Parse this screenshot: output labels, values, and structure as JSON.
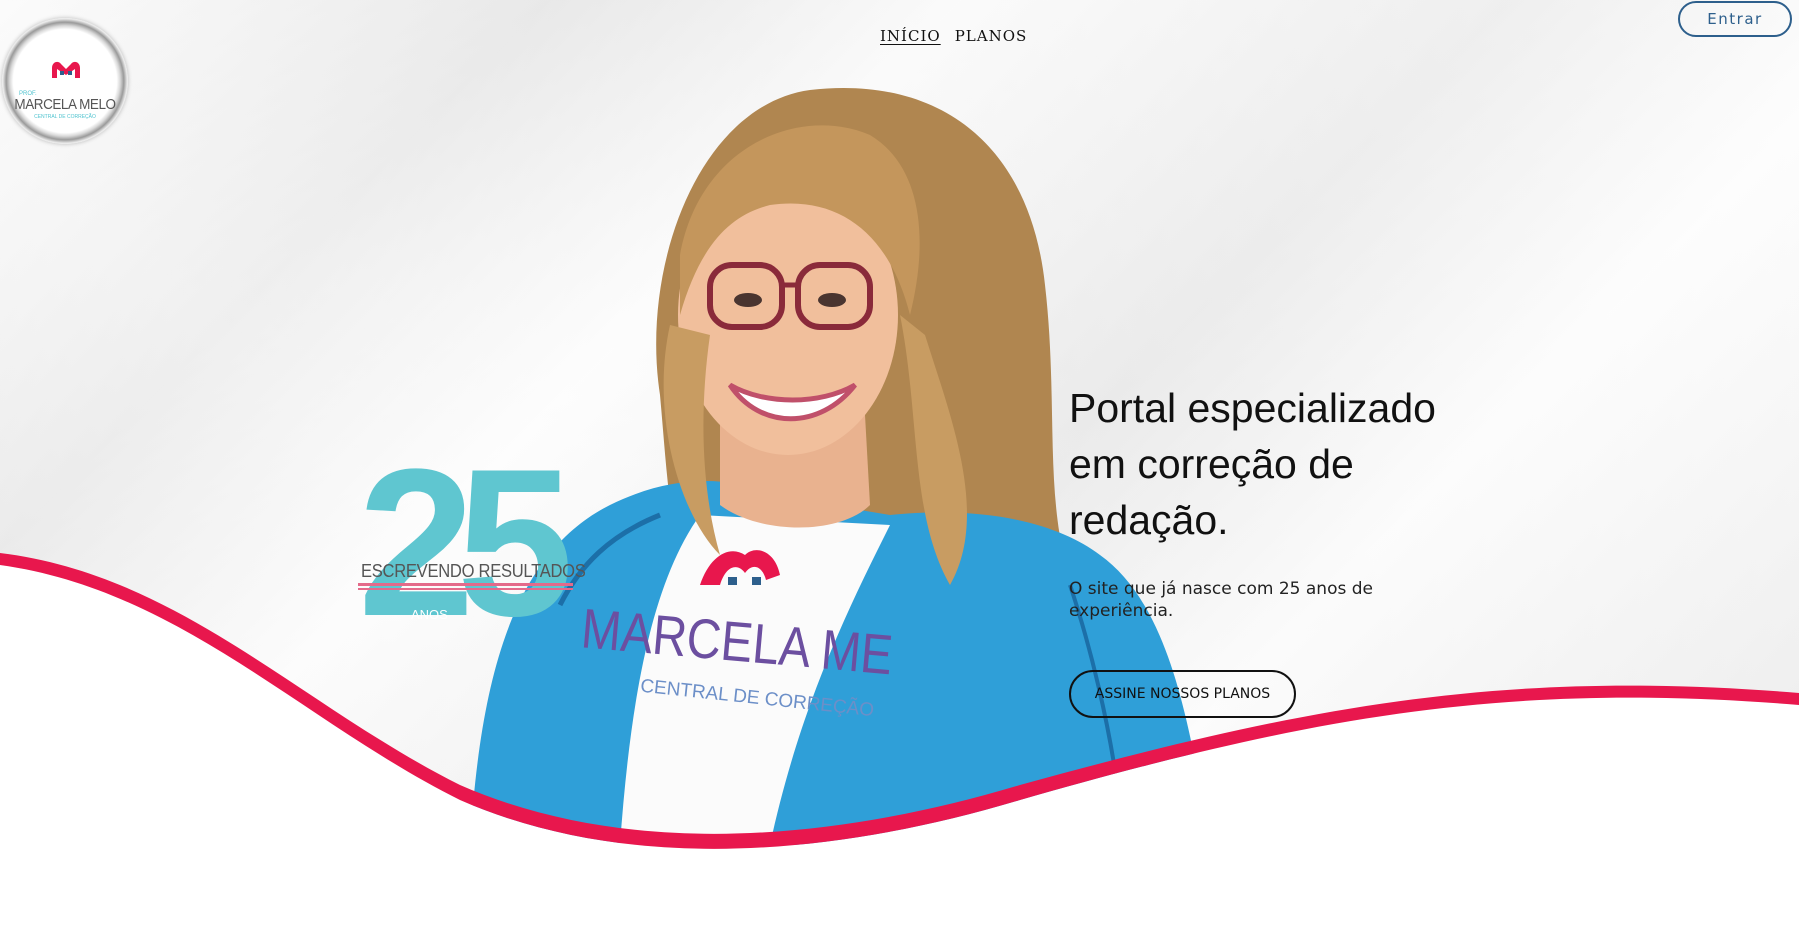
{
  "logo": {
    "prof": "PROF.",
    "name": "MARCELA MELO",
    "subtitle": "CENTRAL DE CORREÇÃO"
  },
  "nav": {
    "items": [
      {
        "label": "INÍCIO",
        "active": true
      },
      {
        "label": "PLANOS",
        "active": false
      }
    ]
  },
  "login_label": "Entrar",
  "badge": {
    "number": "25",
    "text": "ESCREVENDO RESULTADOS",
    "anos": "ANOS"
  },
  "shirt": {
    "name": "MARCELA ME",
    "subtitle": "CENTRAL DE CORREÇÃO"
  },
  "hero": {
    "headline_lines": [
      "Portal especializado",
      "em correção de",
      "redação."
    ],
    "subheadline": "O site que já nasce com 25 anos de experiência.",
    "cta_label": "ASSINE NOSSOS PLANOS"
  },
  "colors": {
    "brand_pink": "#e8174d",
    "brand_teal": "#4fc3cf",
    "login_blue": "#2d5f8c",
    "jacket_blue": "#2f9fd8"
  }
}
